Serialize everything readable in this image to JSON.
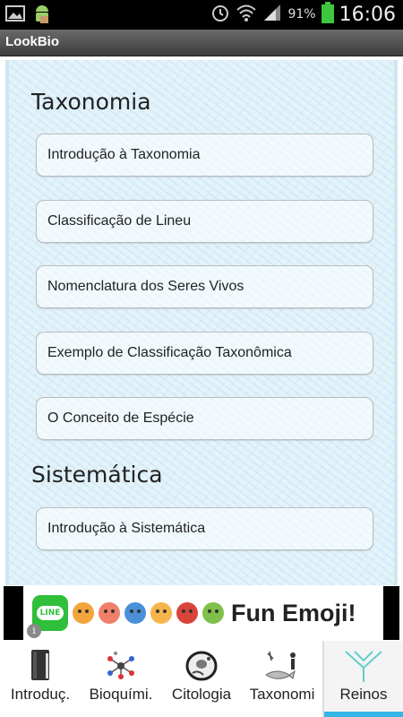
{
  "status_bar": {
    "battery_percent": "91%",
    "time": "16:06",
    "icons": [
      "image-icon",
      "android-icon",
      "alarm-icon",
      "wifi-icon",
      "signal-icon",
      "battery-icon"
    ]
  },
  "app": {
    "title": "LookBio"
  },
  "sections": [
    {
      "title": "Taxonomia",
      "items": [
        "Introdução à Taxonomia",
        "Classificação de Lineu",
        "Nomenclatura dos Seres Vivos",
        "Exemplo de Classificação Taxonômica",
        "O Conceito de Espécie"
      ]
    },
    {
      "title": "Sistemática",
      "items": [
        "Introdução à Sistemática"
      ]
    }
  ],
  "ad": {
    "logo_text": "LINE",
    "text": "Fun Emoji!",
    "info_symbol": "i"
  },
  "tabs": [
    {
      "label": "Introduç.",
      "icon": "book-icon",
      "selected": false
    },
    {
      "label": "Bioquími.",
      "icon": "molecule-icon",
      "selected": false
    },
    {
      "label": "Citologia",
      "icon": "cell-icon",
      "selected": false
    },
    {
      "label": "Taxonomi",
      "icon": "organisms-icon",
      "selected": true
    },
    {
      "label": "Reinos",
      "icon": "tree-icon",
      "selected": false
    }
  ],
  "colors": {
    "accent": "#33b5e5",
    "battery": "#3fc63f",
    "paper": "#e4f3fa"
  }
}
